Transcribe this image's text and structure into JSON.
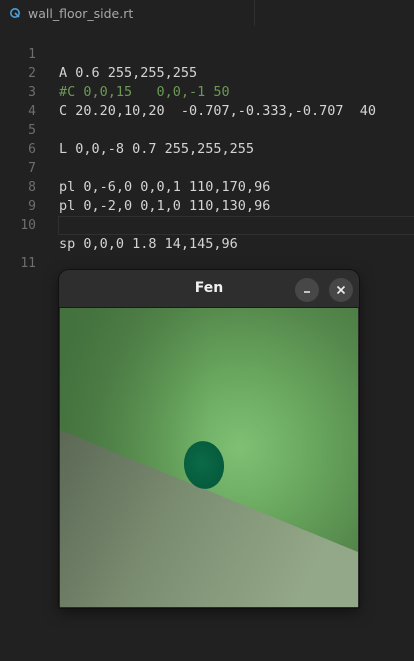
{
  "editor": {
    "tab": {
      "filename": "wall_floor_side.rt",
      "icon": "rt-file-icon"
    },
    "lines": [
      {
        "num": "1",
        "text": "A 0.6 255,255,255"
      },
      {
        "num": "2",
        "text": "#C 0,0,15   0,0,-1 50"
      },
      {
        "num": "3",
        "text": "C 20.20,10,20  -0.707,-0.333,-0.707  40"
      },
      {
        "num": "4",
        "text": ""
      },
      {
        "num": "5",
        "text": "L 0,0,-8 0.7 255,255,255"
      },
      {
        "num": "6",
        "text": ""
      },
      {
        "num": "7",
        "text": "pl 0,-6,0 0,0,1 110,170,96"
      },
      {
        "num": "8",
        "text": "pl 0,-2,0 0,1,0 110,130,96"
      },
      {
        "num": "9",
        "text": ""
      },
      {
        "num": "10",
        "text": "sp 0,0,0 1.8 14,145,96"
      },
      {
        "num": "11",
        "text": ""
      }
    ]
  },
  "window": {
    "title": "Fen",
    "minimize_icon": "minimize-icon",
    "close_icon": "close-icon"
  },
  "colors": {
    "background": "#212121",
    "comment": "#6a9955",
    "line_number": "#6e6e6e"
  }
}
